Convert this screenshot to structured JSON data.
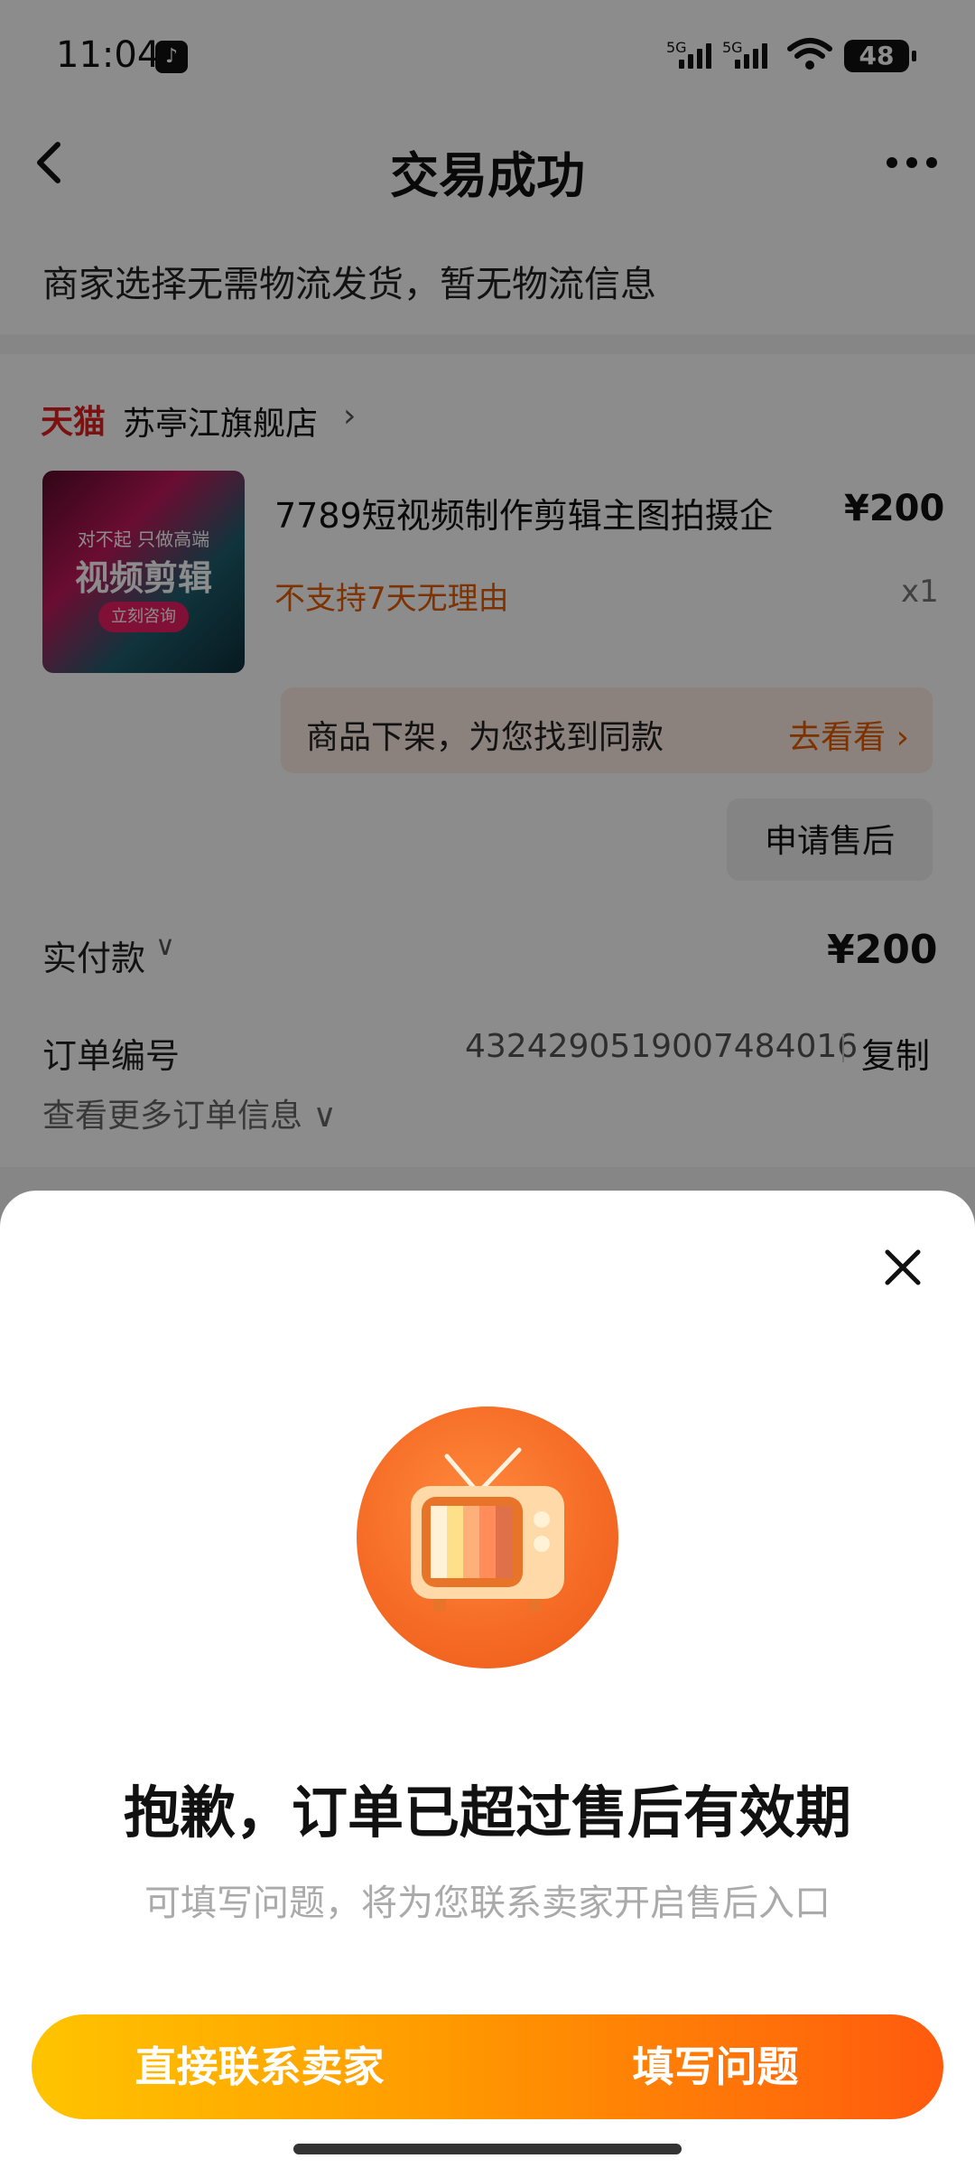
{
  "status_bar": {
    "time": "11:04",
    "network_label_1": "5G",
    "network_label_2": "5G",
    "battery": "48"
  },
  "header": {
    "title": "交易成功"
  },
  "logistics": {
    "text": "商家选择无需物流发货，暂无物流信息"
  },
  "order": {
    "store_badge": "天猫",
    "store_name": "苏亭江旗舰店",
    "product": {
      "thumb_line1": "对不起 只做高端",
      "thumb_line2": "视频剪辑",
      "thumb_button": "立刻咨询",
      "name": "7789短视频制作剪辑主图拍摄企",
      "price": "¥200",
      "tag": "不支持7天无理由",
      "quantity": "x1"
    },
    "similar_banner": {
      "text": "商品下架，为您找到同款",
      "action": "去看看 ›"
    },
    "aftersale_button": "申请售后",
    "paid_label": "实付款",
    "paid_amount": "¥200",
    "order_no_label": "订单编号",
    "order_no": "4324290519007484016",
    "copy_label": "复制",
    "more_info": "查看更多订单信息"
  },
  "sheet": {
    "headline": "抱歉，订单已超过售后有效期",
    "subline": "可填写问题，将为您联系卖家开启售后入口",
    "contact_button": "直接联系卖家",
    "fill_button": "填写问题"
  },
  "colors": {
    "accent_orange": "#ff5a0e",
    "accent_yellow": "#ffc400",
    "tmall_red": "#e02020"
  },
  "icons": [
    "back-icon",
    "more-icon",
    "chevron-right-icon",
    "chevron-down-icon",
    "close-icon",
    "tv-illustration-icon",
    "wifi-icon",
    "tiktok-icon"
  ]
}
